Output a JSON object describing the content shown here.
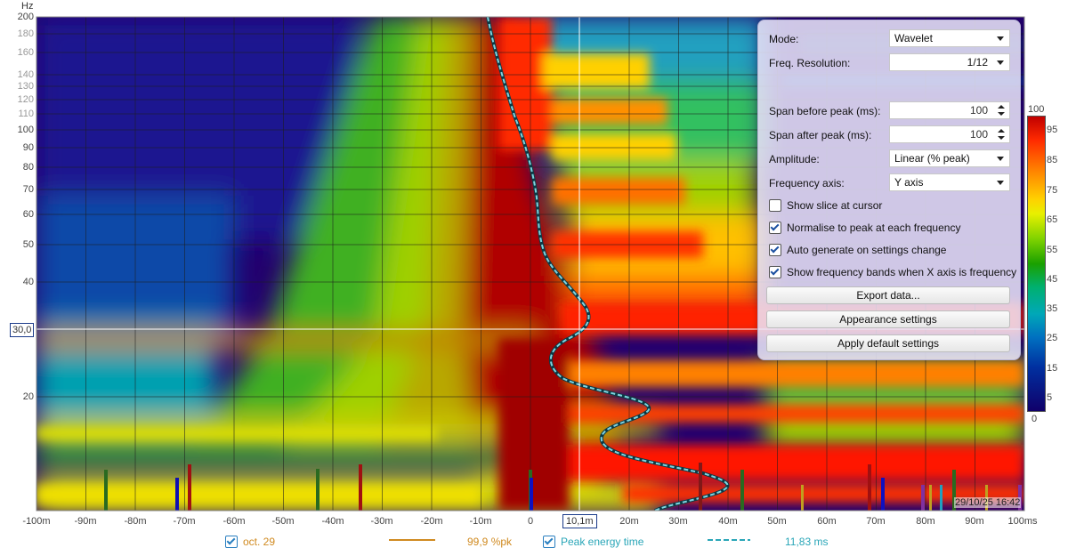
{
  "plot": {
    "y_unit": "Hz",
    "y_ticks": [
      "200",
      "180",
      "160",
      "140",
      "130",
      "120",
      "110",
      "100",
      "90",
      "80",
      "70",
      "60",
      "50",
      "40",
      "30,0",
      "20"
    ],
    "x_ticks": [
      "-100m",
      "-90m",
      "-80m",
      "-70m",
      "-60m",
      "-50m",
      "-40m",
      "-30m",
      "-20m",
      "-10m",
      "0",
      "10,1m",
      "20m",
      "30m",
      "40m",
      "50m",
      "60m",
      "70m",
      "80m",
      "90m",
      "100ms"
    ],
    "cursor_y": "30,0",
    "cursor_x": "10,1m",
    "timestamp": "29/10/25 16:42",
    "colors": {
      "line": "#6fc8d8",
      "cursor": "#ffffff"
    }
  },
  "colorbar": {
    "top_label": "100",
    "bottom_label": "0",
    "ticks": [
      "95",
      "85",
      "75",
      "65",
      "55",
      "45",
      "35",
      "25",
      "15",
      "5"
    ]
  },
  "panel": {
    "mode_label": "Mode:",
    "mode_value": "Wavelet",
    "freq_res_label": "Freq. Resolution:",
    "freq_res_value": "1/12",
    "span_before_label": "Span before peak (ms):",
    "span_before_value": "100",
    "span_after_label": "Span after peak (ms):",
    "span_after_value": "100",
    "amplitude_label": "Amplitude:",
    "amplitude_value": "Linear (% peak)",
    "freq_axis_label": "Frequency axis:",
    "freq_axis_value": "Y axis",
    "show_slice_label": "Show slice at cursor",
    "show_slice_checked": false,
    "normalise_label": "Normalise to peak at each frequency",
    "normalise_checked": true,
    "auto_generate_label": "Auto generate on settings change",
    "auto_generate_checked": true,
    "show_bands_label": "Show frequency bands when X axis is frequency",
    "show_bands_checked": true,
    "export_label": "Export data...",
    "appearance_label": "Appearance settings",
    "defaults_label": "Apply default settings"
  },
  "legend": {
    "series1_name": "oct. 29",
    "series1_value": "99,9 %pk",
    "series1_color": "#d08a20",
    "series2_name": "Peak energy time",
    "series2_value": "11,83 ms",
    "series2_color": "#2aa6b8"
  }
}
